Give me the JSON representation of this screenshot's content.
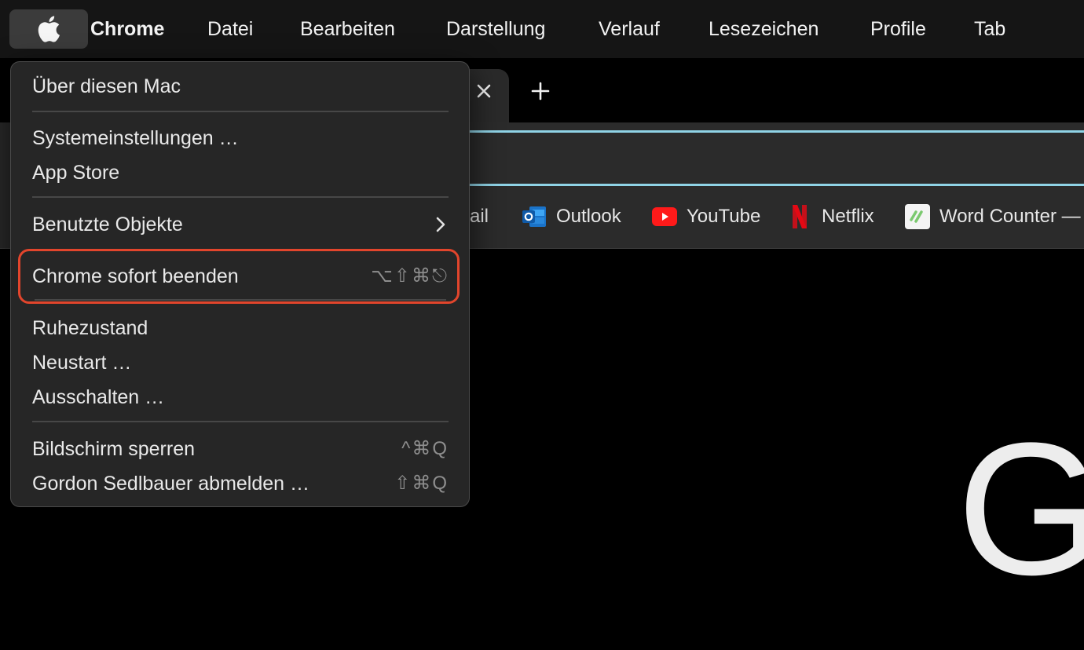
{
  "menubar": {
    "apple_icon": "apple-logo-icon",
    "items": [
      "Chrome",
      "Datei",
      "Bearbeiten",
      "Darstellung",
      "Verlauf",
      "Lesezeichen",
      "Profile",
      "Tab"
    ]
  },
  "apple_menu": {
    "about": "Über diesen Mac",
    "system_settings": "Systemeinstellungen …",
    "app_store": "App Store",
    "recent_items": "Benutzte Objekte",
    "force_quit": "Chrome sofort beenden",
    "force_quit_shortcut": "⌥⇧⌘⎋",
    "sleep": "Ruhezustand",
    "restart": "Neustart …",
    "shut_down": "Ausschalten …",
    "lock_screen": "Bildschirm sperren",
    "lock_screen_shortcut": "^⌘Q",
    "log_out": "Gordon Sedlbauer abmelden …",
    "log_out_shortcut": "⇧⌘Q",
    "highlight_color": "#e2452c"
  },
  "chrome": {
    "tab_close_icon": "close-icon",
    "new_tab_icon": "plus-icon",
    "bookmarks": [
      {
        "label": "ail",
        "icon": "gmail-icon"
      },
      {
        "label": "Outlook",
        "icon": "outlook-icon"
      },
      {
        "label": "YouTube",
        "icon": "youtube-icon"
      },
      {
        "label": "Netflix",
        "icon": "netflix-icon"
      },
      {
        "label": "Word Counter —",
        "icon": "word-counter-icon"
      }
    ],
    "page_logo_partial": "Go",
    "accent_color": "#8fd3e6"
  }
}
